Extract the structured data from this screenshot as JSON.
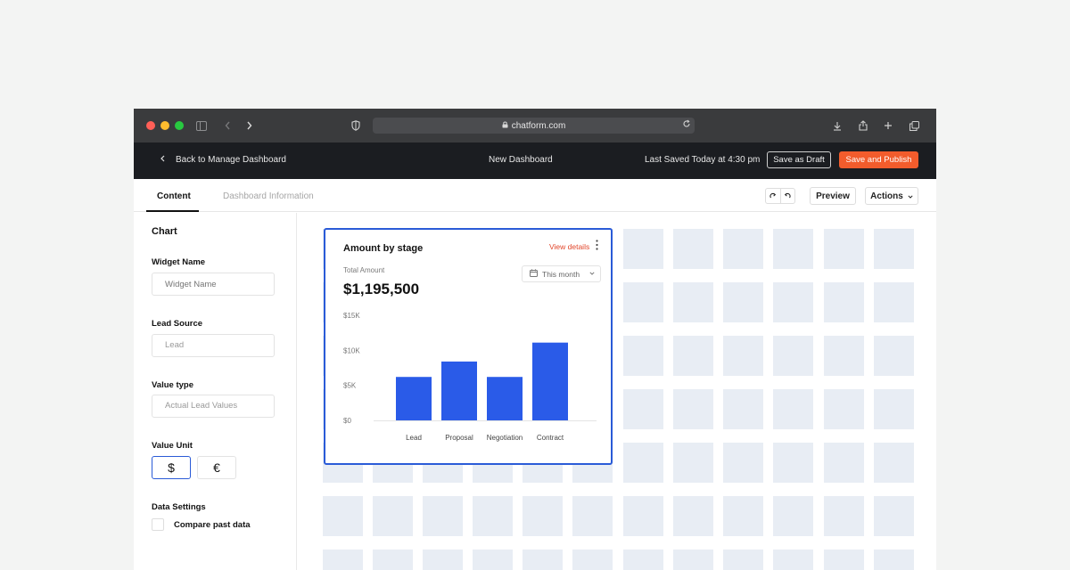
{
  "browser": {
    "url": "chatform.com",
    "traffic_lights": [
      "#ff5f57",
      "#febc2e",
      "#28c840"
    ]
  },
  "header": {
    "back_label": "Back to Manage Dashboard",
    "title": "New Dashboard",
    "saved_status": "Last Saved Today at 4:30 pm",
    "draft_label": "Save as Draft",
    "publish_label": "Save and Publish"
  },
  "tabs": {
    "content": "Content",
    "info": "Dashboard Information",
    "preview_label": "Preview",
    "actions_label": "Actions"
  },
  "sidebar": {
    "title": "Chart",
    "widget_name_label": "Widget Name",
    "widget_name_placeholder": "Widget Name",
    "lead_source_label": "Lead Source",
    "lead_source_value": "Lead",
    "value_type_label": "Value type",
    "value_type_value": "Actual Lead Values",
    "value_unit_label": "Value Unit",
    "units": [
      "$",
      "€"
    ],
    "selected_unit": "$",
    "data_settings_label": "Data Settings",
    "compare_label": "Compare past data",
    "compare_checked": false
  },
  "widget": {
    "title": "Amount by stage",
    "link": "View details",
    "total_label": "Total Amount",
    "total_value": "$1,195,500",
    "period": "This month"
  },
  "chart_data": {
    "type": "bar",
    "categories": [
      "Lead",
      "Proposal",
      "Negotiation",
      "Contract"
    ],
    "values": [
      6200,
      8400,
      6200,
      11100
    ],
    "ylim": [
      0,
      15000
    ],
    "yticks": [
      0,
      5000,
      10000,
      15000
    ],
    "ytick_labels": [
      "$0",
      "$5K",
      "$10K",
      "$15K"
    ],
    "color": "#2a5be8",
    "grid": false
  },
  "colors": {
    "accent": "#f25c2c",
    "selection": "#2a5bd7",
    "tile": "#e8edf4"
  }
}
